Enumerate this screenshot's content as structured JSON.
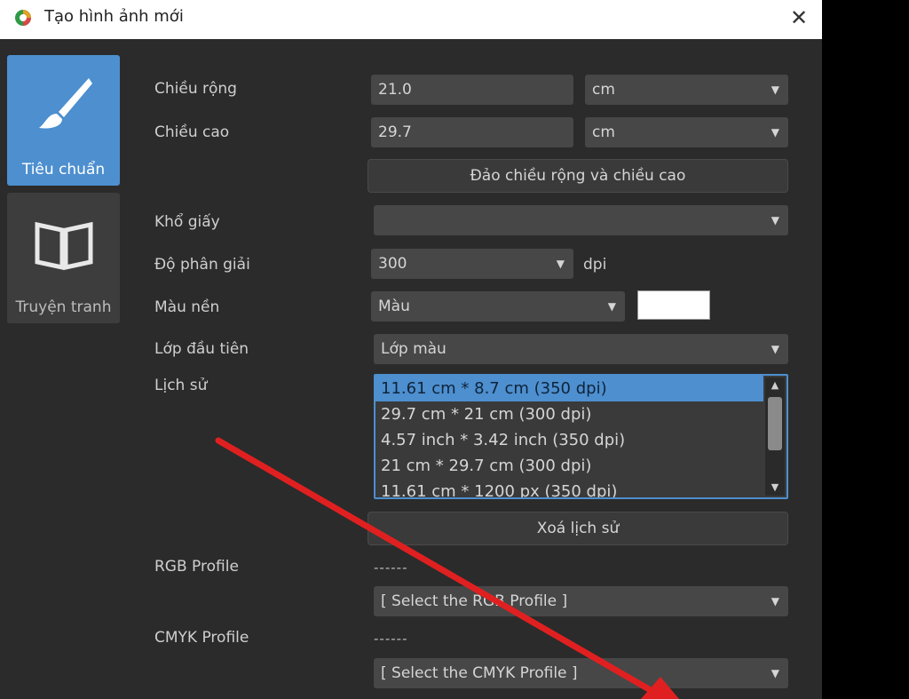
{
  "window": {
    "title": "Tạo hình ảnh mới",
    "close_glyph": "✕"
  },
  "sidebar": {
    "tabs": [
      {
        "label": "Tiêu chuẩn",
        "icon": "paintbrush-icon",
        "active": true
      },
      {
        "label": "Truyện tranh",
        "icon": "book-icon",
        "active": false
      }
    ]
  },
  "form": {
    "width": {
      "label": "Chiều rộng",
      "value": "21.0",
      "unit": "cm"
    },
    "height": {
      "label": "Chiều cao",
      "value": "29.7",
      "unit": "cm"
    },
    "swap_button": "Đảo chiều rộng và chiều cao",
    "paper_size": {
      "label": "Khổ giấy",
      "value": ""
    },
    "resolution": {
      "label": "Độ phân giải",
      "value": "300",
      "unit": "dpi"
    },
    "background": {
      "label": "Màu nền",
      "value": "Màu",
      "color": "#ffffff"
    },
    "first_layer": {
      "label": "Lớp đầu tiên",
      "value": "Lớp màu"
    },
    "history": {
      "label": "Lịch sử",
      "items": [
        "11.61 cm * 8.7 cm (350 dpi)",
        "29.7 cm * 21 cm (300 dpi)",
        "4.57 inch * 3.42 inch (350 dpi)",
        "21 cm * 29.7 cm (300 dpi)",
        "11.61 cm * 1200 px (350 dpi)"
      ],
      "selected_index": 0
    },
    "clear_history_button": "Xoá lịch sử",
    "rgb_profile": {
      "label": "RGB Profile",
      "current": "------",
      "placeholder": "[ Select the RGB Profile ]"
    },
    "cmyk_profile": {
      "label": "CMYK Profile",
      "current": "------",
      "placeholder": "[ Select the CMYK Profile ]"
    }
  },
  "colors": {
    "accent": "#4d8fcf",
    "dialog_bg": "#2b2b2b",
    "annotation_arrow": "#e02020"
  }
}
